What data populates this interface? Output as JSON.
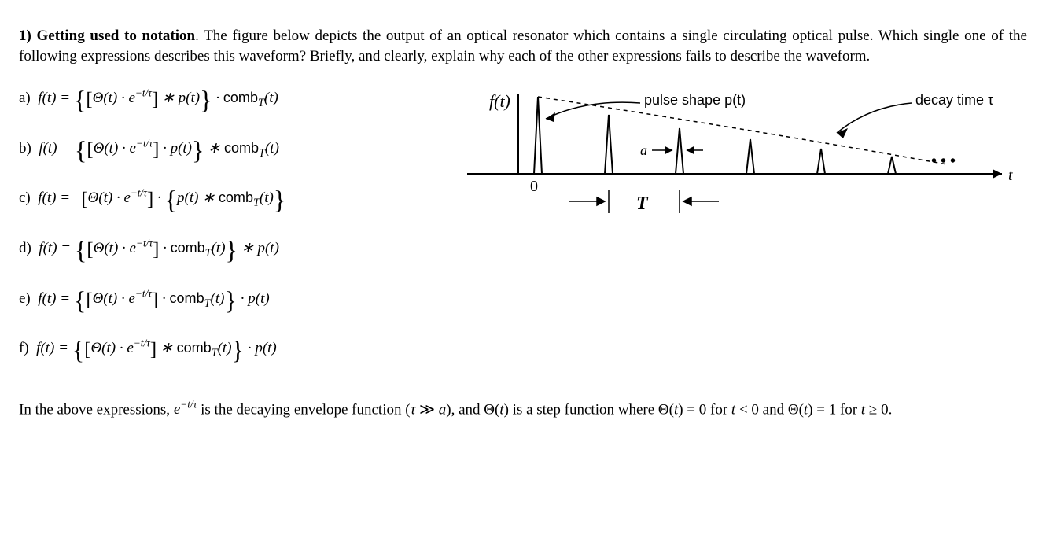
{
  "intro": {
    "bold_lead": "1) Getting used to notation",
    "rest": ". The figure below depicts the output of an optical resonator which contains a single circulating optical pulse. Which single one of the following expressions describes this waveform? Briefly, and clearly, explain why each of the other expressions fails to describe the waveform."
  },
  "options": [
    {
      "label": "a)",
      "expr_html": "f(t) = <span class='big'>{</span><span class='mid'>[</span>Θ(t) · e<sup>−t/τ</sup><span class='mid'>]</span> ∗ p(t)<span class='big'>}</span> · <span class='fn'>comb</span><sub>T</sub>(t)"
    },
    {
      "label": "b)",
      "expr_html": "f(t) = <span class='big'>{</span><span class='mid'>[</span>Θ(t) · e<sup>−t/τ</sup><span class='mid'>]</span> · p(t)<span class='big'>}</span> ∗ <span class='fn'>comb</span><sub>T</sub>(t)"
    },
    {
      "label": "c)",
      "expr_html": "f(t) = &nbsp;&nbsp;<span class='mid'>[</span>Θ(t) · e<sup>−t/τ</sup><span class='mid'>]</span> · <span class='big'>{</span>p(t) ∗ <span class='fn'>comb</span><sub>T</sub>(t)<span class='big'>}</span>"
    },
    {
      "label": "d)",
      "expr_html": "f(t) = <span class='big'>{</span><span class='mid'>[</span>Θ(t) · e<sup>−t/τ</sup><span class='mid'>]</span> · <span class='fn'>comb</span><sub>T</sub>(t)<span class='big'>}</span> ∗ p(t)"
    },
    {
      "label": "e)",
      "expr_html": "f(t) = <span class='big'>{</span><span class='mid'>[</span>Θ(t) · e<sup>−t/τ</sup><span class='mid'>]</span> · <span class='fn'>comb</span><sub>T</sub>(t)<span class='big'>}</span> · p(t)"
    },
    {
      "label": "f)",
      "expr_html": "f(t) = <span class='big'>{</span><span class='mid'>[</span>Θ(t) · e<sup>−t/τ</sup><span class='mid'>]</span> ∗ <span class='fn'>comb</span><sub>T</sub>(t)<span class='big'>}</span> · p(t)"
    }
  ],
  "figure": {
    "ylabel": "f(t)",
    "pulse_shape_label": "pulse shape p(t)",
    "decay_time_label": "decay time τ",
    "a_label": "a",
    "T_label": "T",
    "t_label": "t",
    "zero_label": "0",
    "dots": "• • •"
  },
  "closing_html": "In the above expressions, <span class='math'>e<sup>−t/τ</sup></span> is the decaying envelope function (<span class='math'>τ</span> ≫ <span class='math'>a</span>), and Θ(<span class='math'>t</span>) is a step function where Θ(<span class='math'>t</span>) = 0 for <span class='math'>t</span> &lt; 0 and Θ(<span class='math'>t</span>) = 1 for <span class='math'>t</span> ≥ 0."
}
